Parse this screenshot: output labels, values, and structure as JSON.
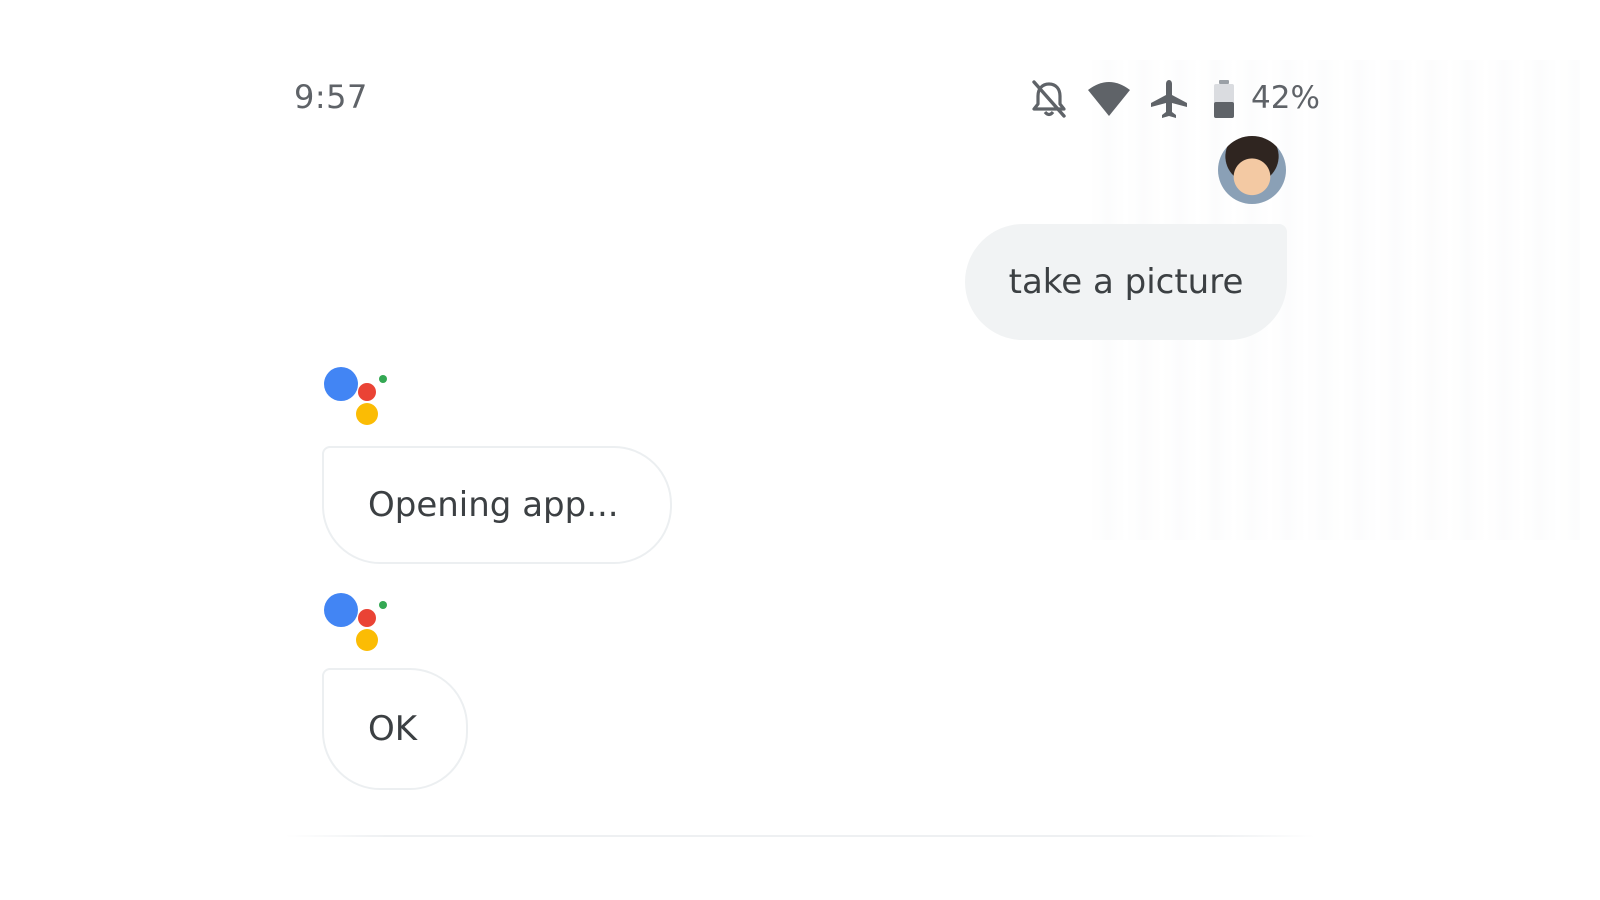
{
  "status_bar": {
    "time": "9:57",
    "battery_percent": "42%",
    "icons": [
      "notifications-off-icon",
      "wifi-icon",
      "airplane-mode-icon",
      "battery-icon"
    ]
  },
  "conversation": {
    "user_message": "take a picture",
    "assistant_messages": [
      "Opening app...",
      "OK"
    ]
  },
  "colors": {
    "bubble_user": "#f1f3f4",
    "bubble_assistant": "#ffffff",
    "assistant_blue": "#4285f4",
    "assistant_red": "#ea4335",
    "assistant_yellow": "#fbbc04",
    "assistant_green": "#34a853",
    "icon_gray": "#5f6368"
  }
}
